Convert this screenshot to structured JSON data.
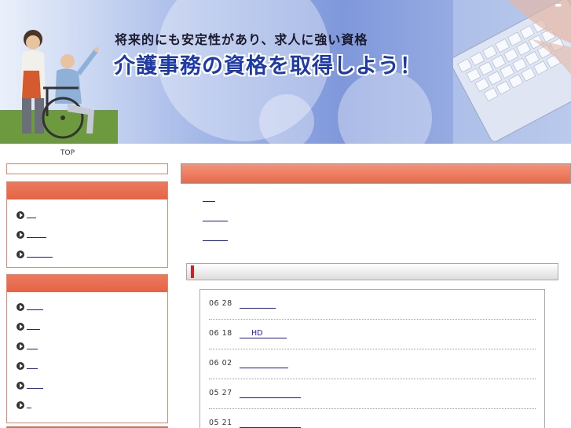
{
  "header": {
    "tagline": "将来的にも安定性があり、求人に強い資格",
    "title": "介護事務の資格を取得しよう！"
  },
  "breadcrumb": {
    "label": "TOP"
  },
  "sidebar": {
    "box1_items": [
      "",
      "",
      ""
    ],
    "box2_items": [
      "",
      "",
      "",
      "",
      "",
      ""
    ]
  },
  "main_links": [
    "",
    "",
    ""
  ],
  "news": [
    {
      "date": "06 28",
      "title": ""
    },
    {
      "date": "06 18",
      "title": "HD"
    },
    {
      "date": "06 02",
      "title": ""
    },
    {
      "date": "05 27",
      "title": ""
    },
    {
      "date": "05 21",
      "title": ""
    }
  ],
  "colors": {
    "accent": "#e56446",
    "link": "#1a1acc",
    "title_blue": "#1e3aa8",
    "header_blue": "#8ea6e0"
  }
}
